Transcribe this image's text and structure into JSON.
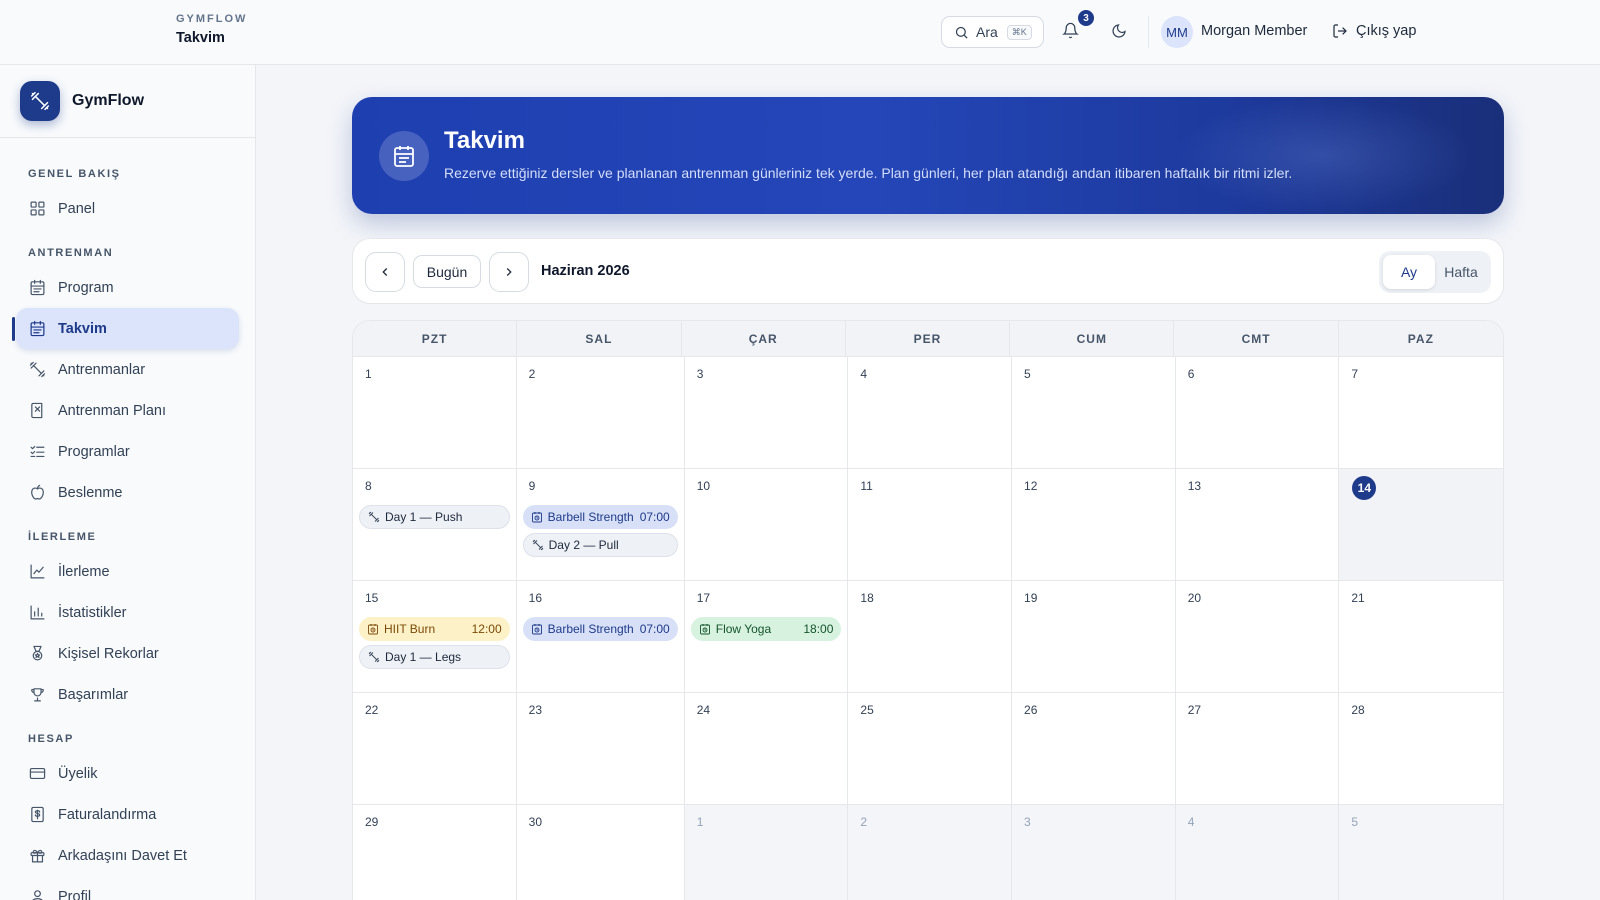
{
  "header": {
    "app_name": "GYMFLOW",
    "page_title": "Takvim",
    "search_label": "Ara",
    "search_shortcut": "⌘K",
    "notification_count": "3",
    "user_initials": "MM",
    "user_name": "Morgan Member",
    "logout_label": "Çıkış yap"
  },
  "sidebar": {
    "brand": "GymFlow",
    "sections": [
      {
        "title": "GENEL BAKIŞ",
        "items": [
          {
            "label": "Panel",
            "icon": "grid-icon"
          }
        ]
      },
      {
        "title": "ANTRENMAN",
        "items": [
          {
            "label": "Program",
            "icon": "calendar-icon"
          },
          {
            "label": "Takvim",
            "icon": "calendar-icon",
            "active": true
          },
          {
            "label": "Antrenmanlar",
            "icon": "dumbbell-icon"
          },
          {
            "label": "Antrenman Planı",
            "icon": "notebook-icon"
          },
          {
            "label": "Programlar",
            "icon": "checklist-icon"
          },
          {
            "label": "Beslenme",
            "icon": "apple-icon"
          }
        ]
      },
      {
        "title": "İLERLEME",
        "items": [
          {
            "label": "İlerleme",
            "icon": "line-chart-icon"
          },
          {
            "label": "İstatistikler",
            "icon": "bar-chart-icon"
          },
          {
            "label": "Kişisel Rekorlar",
            "icon": "medal-icon"
          },
          {
            "label": "Başarımlar",
            "icon": "trophy-icon"
          }
        ]
      },
      {
        "title": "HESAP",
        "items": [
          {
            "label": "Üyelik",
            "icon": "credit-card-icon"
          },
          {
            "label": "Faturalandırma",
            "icon": "invoice-icon"
          },
          {
            "label": "Arkadaşını Davet Et",
            "icon": "gift-icon"
          },
          {
            "label": "Profil",
            "icon": "user-icon"
          }
        ]
      }
    ]
  },
  "hero": {
    "title": "Takvim",
    "subtitle": "Rezerve ettiğiniz dersler ve planlanan antrenman günleriniz tek yerde. Plan günleri, her plan atandığı andan itibaren haftalık bir ritmi izler."
  },
  "toolbar": {
    "today_label": "Bugün",
    "month_label": "Haziran 2026",
    "view_month": "Ay",
    "view_week": "Hafta"
  },
  "calendar": {
    "weekdays": [
      "PZT",
      "SAL",
      "ÇAR",
      "PER",
      "CUM",
      "CMT",
      "PAZ"
    ],
    "days": [
      {
        "day": "1"
      },
      {
        "day": "2"
      },
      {
        "day": "3"
      },
      {
        "day": "4"
      },
      {
        "day": "5"
      },
      {
        "day": "6"
      },
      {
        "day": "7"
      },
      {
        "day": "8",
        "events": [
          {
            "title": "Day 1 — Push",
            "kind": "plan"
          }
        ]
      },
      {
        "day": "9",
        "events": [
          {
            "title": "Barbell Strength",
            "time": "07:00",
            "kind": "cls-blue"
          },
          {
            "title": "Day 2 — Pull",
            "kind": "plan"
          }
        ]
      },
      {
        "day": "10"
      },
      {
        "day": "11"
      },
      {
        "day": "12"
      },
      {
        "day": "13"
      },
      {
        "day": "14",
        "today": true
      },
      {
        "day": "15",
        "events": [
          {
            "title": "HIIT Burn",
            "time": "12:00",
            "kind": "cls-yellow"
          },
          {
            "title": "Day 1 — Legs",
            "kind": "plan"
          }
        ]
      },
      {
        "day": "16",
        "events": [
          {
            "title": "Barbell Strength",
            "time": "07:00",
            "kind": "cls-blue"
          }
        ]
      },
      {
        "day": "17",
        "events": [
          {
            "title": "Flow Yoga",
            "time": "18:00",
            "kind": "cls-green"
          }
        ]
      },
      {
        "day": "18"
      },
      {
        "day": "19"
      },
      {
        "day": "20"
      },
      {
        "day": "21"
      },
      {
        "day": "22"
      },
      {
        "day": "23"
      },
      {
        "day": "24"
      },
      {
        "day": "25"
      },
      {
        "day": "26"
      },
      {
        "day": "27"
      },
      {
        "day": "28"
      },
      {
        "day": "29"
      },
      {
        "day": "30"
      },
      {
        "day": "1",
        "outside": true
      },
      {
        "day": "2",
        "outside": true
      },
      {
        "day": "3",
        "outside": true
      },
      {
        "day": "4",
        "outside": true
      },
      {
        "day": "5",
        "outside": true
      }
    ]
  }
}
